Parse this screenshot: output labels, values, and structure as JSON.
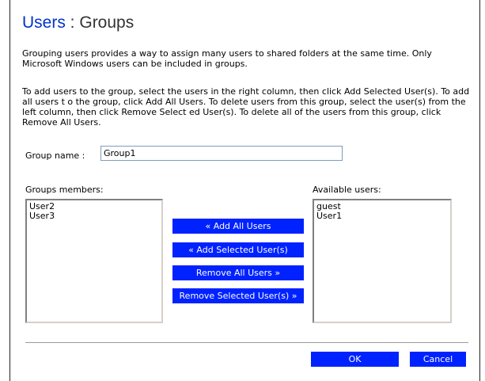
{
  "header": {
    "link": "Users",
    "separator": " : ",
    "page": "Groups"
  },
  "intro": {
    "description": "Grouping users provides a way to assign many users to shared folders at the same time. Only Microsoft Windows users can be included in groups.",
    "instructions": "To add users to the group, select the users in the right column, then click Add Selected User(s). To add all users t o the group, click Add All Users. To delete users from this group, select the user(s) from the left column, then click Remove Select ed User(s). To delete all of the users from this group, click Remove All Users."
  },
  "group_name": {
    "label": "Group name  :",
    "value": "Group1"
  },
  "members": {
    "label": "Groups members:",
    "items": [
      "User2",
      "User3"
    ]
  },
  "available": {
    "label": "Available users:",
    "items": [
      "guest",
      "User1"
    ]
  },
  "actions": {
    "add_all": "« Add All Users",
    "add_selected": "« Add Selected User(s)",
    "remove_all": "Remove All Users »",
    "remove_selected": "Remove Selected User(s) »"
  },
  "footer": {
    "ok": "OK",
    "cancel": "Cancel"
  },
  "colors": {
    "accent_button": "#0022ff",
    "title_link": "#0033cc"
  }
}
